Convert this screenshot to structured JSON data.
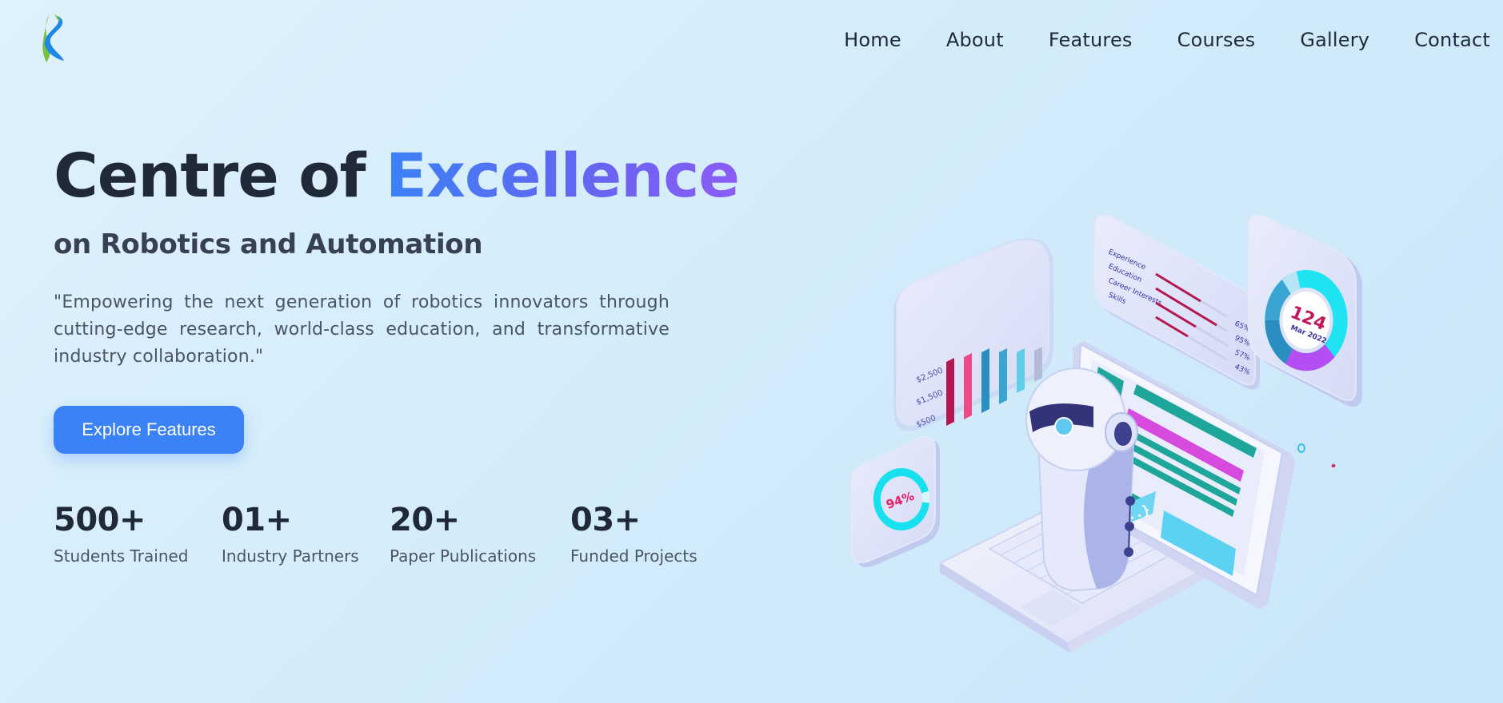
{
  "brand": {
    "logo_icon": "kr-leaf-logo-icon",
    "colors": {
      "green": "#7ac143",
      "blue": "#1e88e5"
    }
  },
  "nav": {
    "items": [
      {
        "label": "Home"
      },
      {
        "label": "About"
      },
      {
        "label": "Features"
      },
      {
        "label": "Courses"
      },
      {
        "label": "Gallery"
      },
      {
        "label": "Contact"
      }
    ]
  },
  "hero": {
    "title_part1": "Centre of ",
    "title_part2": "Excellence",
    "subtitle": "on Robotics and Automation",
    "quote": "\"Empowering the next generation of robotics innovators through cutting-edge research, world-class education, and transformative industry collaboration.\"",
    "cta_label": "Explore Features",
    "accent_color": "#3b82f6"
  },
  "stats": [
    {
      "value": "500+",
      "label": "Students Trained"
    },
    {
      "value": "01+",
      "label": "Industry Partners"
    },
    {
      "value": "20+",
      "label": "Paper Publications"
    },
    {
      "value": "03+",
      "label": "Funded Projects"
    }
  ],
  "illustration": {
    "bar_panel": {
      "ticks": [
        "$2,500",
        "$1,500",
        "$500"
      ]
    },
    "list_panel": {
      "rows": [
        {
          "label": "Experience",
          "pct": "65%"
        },
        {
          "label": "Education",
          "pct": "95%"
        },
        {
          "label": "Career Interests",
          "pct": "57%"
        },
        {
          "label": "Skills",
          "pct": "43%"
        }
      ]
    },
    "donut_panel": {
      "value": "124",
      "date": "Mar 2022"
    },
    "ring_panel": {
      "value": "94%"
    },
    "code_snippet": "{...}"
  }
}
